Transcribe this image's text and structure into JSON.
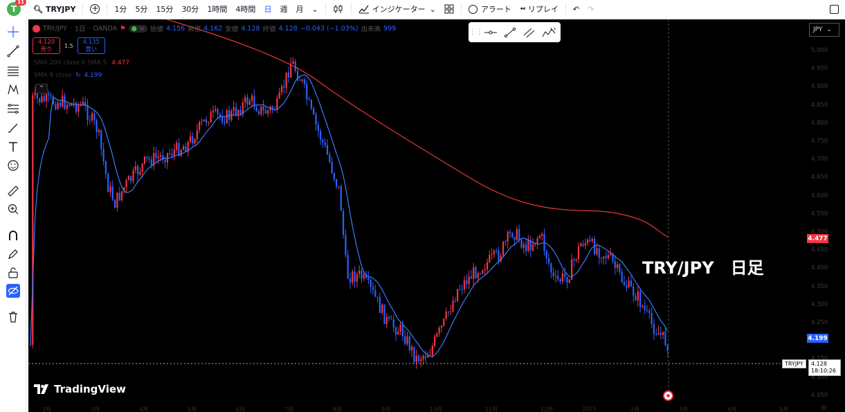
{
  "topbar": {
    "avatar_letter": "T",
    "notification_count": "11",
    "symbol": "TRYJPY",
    "intervals": [
      "1分",
      "5分",
      "15分",
      "30分",
      "1時間",
      "4時間",
      "日",
      "週",
      "月"
    ],
    "active_interval": "日",
    "indicators_label": "インジケーター",
    "alert_label": "アラート",
    "replay_label": "リプレイ"
  },
  "chart": {
    "legend": {
      "pair": "TRY/JPY",
      "timeframe": "1日",
      "broker": "OANDA",
      "open_label": "始値",
      "open": "4.156",
      "high_label": "高値",
      "high": "4.162",
      "low_label": "安値",
      "low": "4.128",
      "close_label": "終値",
      "close": "4.128",
      "change": "−0.043 (−1.03%)",
      "volume_label": "出来高",
      "volume": "999"
    },
    "sell": {
      "price": "4.120",
      "label": "売り"
    },
    "buy": {
      "price": "4.135",
      "label": "買い"
    },
    "spread": "1.5",
    "indicator_sma200": {
      "label": "SMA 200 close 0 SMA 5",
      "value": "4.477"
    },
    "indicator_sma9": {
      "label": "SMA 9 close",
      "value": "4.199"
    },
    "currency": "JPY",
    "price_axis": [
      "5.000",
      "4.950",
      "4.900",
      "4.850",
      "4.800",
      "4.750",
      "4.700",
      "4.650",
      "4.600",
      "4.550",
      "4.500",
      "4.450",
      "4.400",
      "4.350",
      "4.300",
      "4.250",
      "4.200",
      "4.150",
      "4.100",
      "4.050"
    ],
    "sma200_tag": "4.477",
    "sma9_tag": "4.199",
    "symbol_tag": "TRYJPY",
    "last_price": "4.128",
    "countdown": "18:10:26",
    "watermark": "TRY/JPY　日足",
    "logo_text": "TradingView",
    "time_axis": [
      "2月",
      "3月",
      "4月",
      "5月",
      "6月",
      "7月",
      "8月",
      "9月",
      "10月",
      "11月",
      "12月",
      "2025",
      "2月",
      "3月",
      "4月",
      "5月"
    ],
    "colors": {
      "up": "#f23645",
      "down": "#2962ff",
      "sma200": "#e53935",
      "sma9": "#3d7bff"
    }
  }
}
